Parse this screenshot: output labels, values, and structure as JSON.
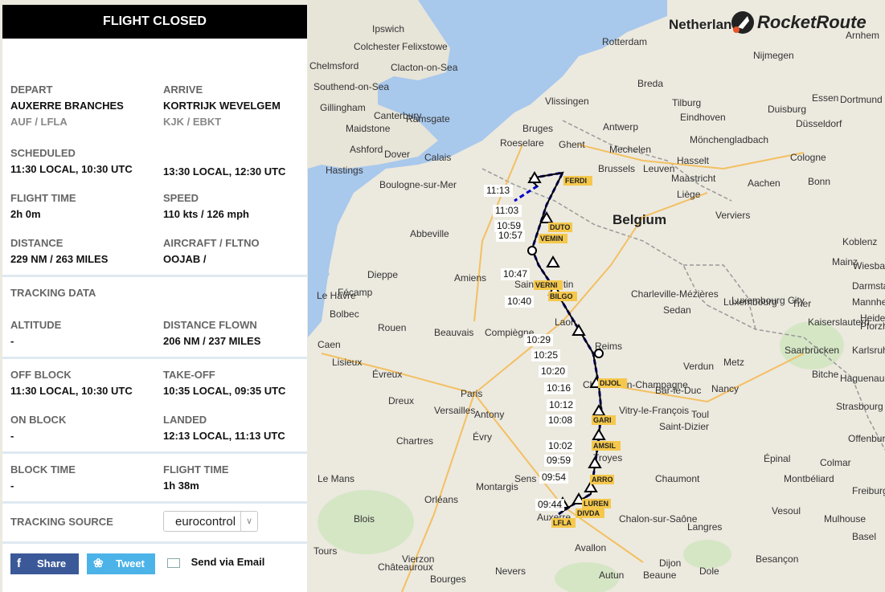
{
  "header": {
    "title": "FLIGHT CLOSED"
  },
  "brand": {
    "logo_text": "RocketRoute"
  },
  "depart": {
    "label": "DEPART",
    "name": "AUXERRE BRANCHES",
    "codes": "AUF / LFLA"
  },
  "arrive": {
    "label": "ARRIVE",
    "name": "KORTRIJK WEVELGEM",
    "codes": "KJK / EBKT"
  },
  "scheduled": {
    "label": "SCHEDULED",
    "depart": "11:30 LOCAL, 10:30 UTC",
    "arrive": "13:30 LOCAL, 12:30 UTC"
  },
  "flight_time": {
    "label": "FLIGHT TIME",
    "value": "2h 0m"
  },
  "speed": {
    "label": "SPEED",
    "value": "110 kts / 126 mph"
  },
  "distance": {
    "label": "DISTANCE",
    "value": "229 NM / 263 MILES"
  },
  "aircraft": {
    "label": "AIRCRAFT / FLTNO",
    "value": "OOJAB /"
  },
  "tracking": {
    "title": "TRACKING DATA"
  },
  "altitude": {
    "label": "ALTITUDE",
    "value": "-"
  },
  "distance_flown": {
    "label": "DISTANCE FLOWN",
    "value": "206 NM / 237 MILES"
  },
  "off_block": {
    "label": "OFF BLOCK",
    "value": "11:30 LOCAL, 10:30 UTC"
  },
  "take_off": {
    "label": "TAKE-OFF",
    "value": "10:35 LOCAL, 09:35 UTC"
  },
  "on_block": {
    "label": "ON BLOCK",
    "value": "-"
  },
  "landed": {
    "label": "LANDED",
    "value": "12:13 LOCAL, 11:13 UTC"
  },
  "block_time": {
    "label": "BLOCK TIME",
    "value": "-"
  },
  "flight_time_actual": {
    "label": "FLIGHT TIME",
    "value": "1h 38m"
  },
  "tracking_source": {
    "label": "TRACKING SOURCE",
    "selected": "eurocontrol"
  },
  "share": {
    "facebook": "Share",
    "twitter": "Tweet",
    "email": "Send via Email"
  },
  "map": {
    "cities": [
      "Ipswich",
      "Colchester",
      "Felixstowe",
      "Chelmsford",
      "Clacton-on-Sea",
      "Southend-on-Sea",
      "Gillingham",
      "Canterbury",
      "Vlissingen",
      "Maidstone",
      "Ramsgate",
      "Ashford",
      "Dover",
      "Hastings",
      "Calais",
      "Boulogne-sur-Mer",
      "Bruges",
      "Roeselare",
      "Ghent",
      "Antwerp",
      "Brussels",
      "Mechelen",
      "Leuven",
      "Hasselt",
      "Maastricht",
      "Liege",
      "Verviers",
      "Aachen",
      "Cologne",
      "Bonn",
      "Dusseldorf",
      "Monchengladbach",
      "Duisburg",
      "Essen",
      "Dortmund",
      "Rotterdam",
      "Breda",
      "Tilburg",
      "Eindhoven",
      "Nijmegen",
      "Arnhem",
      "Koblenz",
      "Wiesbaden",
      "Luxembourg City",
      "Trier",
      "Saarbrucken",
      "Metz",
      "Nancy",
      "Strasbourg",
      "Mulhouse",
      "Basel",
      "Freiburg",
      "Dijon",
      "Besancon",
      "Chaumont",
      "Langres",
      "Saint-Dizier",
      "Vitry-le-Francois",
      "Chalons-en-Champagne",
      "Reims",
      "Laon",
      "Saint-Quentin",
      "Amiens",
      "Abbeville",
      "Dieppe",
      "Le Havre",
      "Rouen",
      "Beauvais",
      "Compiegne",
      "Paris",
      "Versailles",
      "Antony",
      "Evry",
      "Chartres",
      "Orleans",
      "Auxerre",
      "Avallon",
      "Nevers",
      "Bourges",
      "Montargis",
      "Sens",
      "Troyes",
      "Charleville-Mezieres",
      "Sedan",
      "Evreux",
      "Lisieux",
      "Caen",
      "Bolbec",
      "Fecamp",
      "Dreux",
      "Le Mans",
      "Blois",
      "Tours",
      "Chateauroux",
      "Vierzon",
      "Autun",
      "Beaune",
      "Chalon-sur-Saone",
      "Dole",
      "Montbeliard",
      "Epinal",
      "Colmar",
      "Vesoul",
      "Toul",
      "Verdun",
      "Bar-le-Duc",
      "Bitche",
      "Haguenau",
      "Karlsruhe",
      "Pforzheim",
      "Offenburg",
      "Mainz",
      "Darmstadt",
      "Mannheim",
      "Heidelberg",
      "Kaiserslautern"
    ],
    "country_labels": {
      "belgium": "Belgium",
      "luxembourg": "Luxembourg",
      "netherlands": "Netherlands"
    },
    "times": [
      "11:13",
      "11:03",
      "10:59",
      "10:57",
      "10:47",
      "10:40",
      "10:29",
      "10:25",
      "10:20",
      "10:16",
      "10:12",
      "10:08",
      "10:02",
      "09:59",
      "09:54",
      "09:44"
    ],
    "waypoints": [
      "LFLA",
      "LUREN",
      "DIVDA",
      "FERDI",
      "DUTO",
      "VEMIN",
      "VERNI",
      "BILGO",
      "GARI",
      "AMSIL",
      "DIJOL",
      "ARRO"
    ]
  },
  "colors": {
    "header_bg": "#000000",
    "facebook": "#3b5998",
    "twitter": "#4cb3e8",
    "sea": "#a8c8ec",
    "land": "#ece9df",
    "route": "#0000cc",
    "wp_bg": "#f5c84c"
  }
}
